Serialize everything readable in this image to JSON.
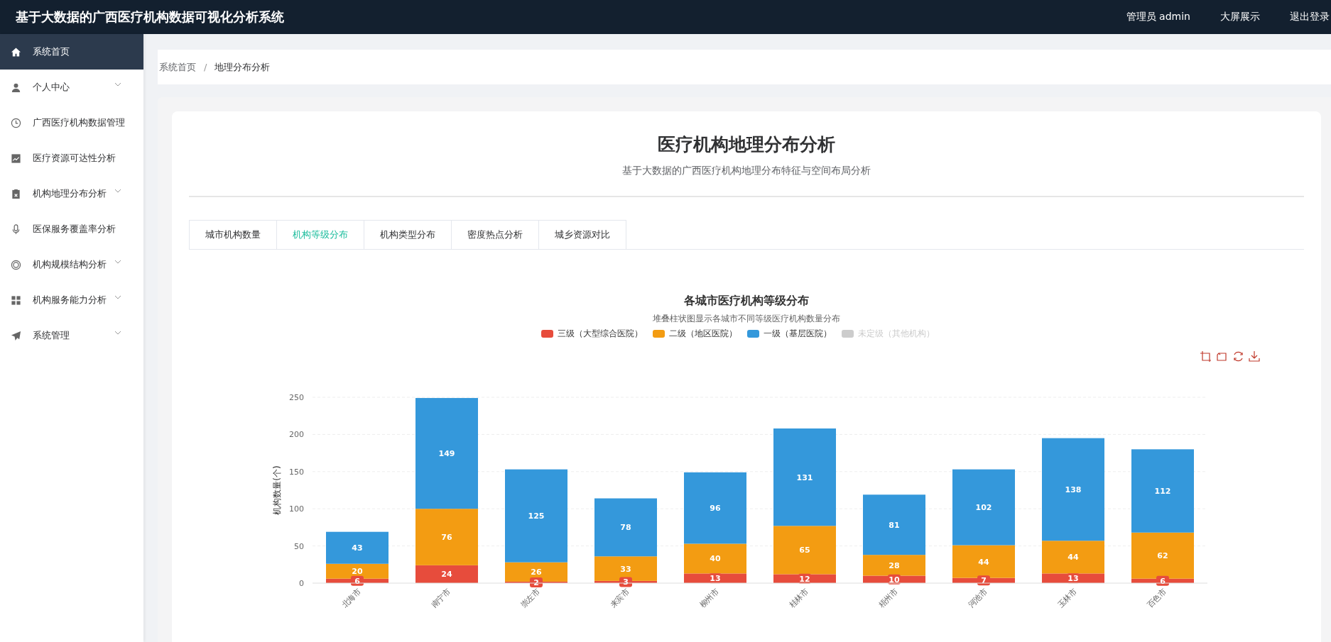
{
  "header": {
    "title": "基于大数据的广西医疗机构数据可视化分析系统",
    "links": [
      "管理员 admin",
      "大屏展示",
      "退出登录"
    ]
  },
  "sidebar": {
    "items": [
      {
        "label": "系统首页",
        "selected": true,
        "expandable": false
      },
      {
        "label": "个人中心",
        "selected": false,
        "expandable": true
      },
      {
        "label": "广西医疗机构数据管理",
        "selected": false,
        "expandable": false
      },
      {
        "label": "医疗资源可达性分析",
        "selected": false,
        "expandable": false
      },
      {
        "label": "机构地理分布分析",
        "selected": false,
        "expandable": true
      },
      {
        "label": "医保服务覆盖率分析",
        "selected": false,
        "expandable": false
      },
      {
        "label": "机构规模结构分析",
        "selected": false,
        "expandable": true
      },
      {
        "label": "机构服务能力分析",
        "selected": false,
        "expandable": true
      },
      {
        "label": "系统管理",
        "selected": false,
        "expandable": true
      }
    ]
  },
  "breadcrumb": [
    "系统首页",
    "/",
    "地理分布分析"
  ],
  "page": {
    "title": "医疗机构地理分布分析",
    "subtitle": "基于大数据的广西医疗机构地理分布特征与空间布局分析"
  },
  "tabs": [
    {
      "label": "城市机构数量",
      "selected": false
    },
    {
      "label": "机构等级分布",
      "selected": true
    },
    {
      "label": "机构类型分布",
      "selected": false
    },
    {
      "label": "密度热点分析",
      "selected": false
    },
    {
      "label": "城乡资源对比",
      "selected": false
    }
  ],
  "chart": {
    "subtitle": "堆叠柱状图显示各城市不同等级医疗机构数量分布",
    "legend_items": [
      {
        "selected": true
      },
      {
        "selected": true
      },
      {
        "selected": true
      },
      {
        "selected": false
      }
    ],
    "chart_data": {
      "type": "bar",
      "title": "各城市医疗机构等级分布",
      "ylabel": "机构数量(个)",
      "stacked": true,
      "data_labels": true,
      "grid": true,
      "legend": true,
      "ylim": [
        0,
        250
      ],
      "yticks": [
        0,
        50,
        100,
        150,
        200,
        250
      ],
      "categories": [
        "北海市",
        "南宁市",
        "崇左市",
        "来宾市",
        "柳州市",
        "桂林市",
        "梧州市",
        "河池市",
        "玉林市",
        "百色市"
      ],
      "series": [
        {
          "name": "三级（大型综合医院）",
          "color": "#e74c3c",
          "values": [
            6,
            24,
            2,
            3,
            13,
            12,
            10,
            7,
            13,
            6
          ]
        },
        {
          "name": "二级（地区医院）",
          "color": "#f39c12",
          "values": [
            20,
            76,
            26,
            33,
            40,
            65,
            28,
            44,
            44,
            62
          ]
        },
        {
          "name": "一级（基层医院）",
          "color": "#3498db",
          "values": [
            43,
            149,
            125,
            78,
            96,
            131,
            81,
            102,
            138,
            112
          ]
        },
        {
          "name": "未定级（其他机构）",
          "color": "#cccccc",
          "values": [
            null,
            null,
            null,
            null,
            null,
            null,
            null,
            null,
            null,
            null
          ]
        }
      ]
    }
  }
}
